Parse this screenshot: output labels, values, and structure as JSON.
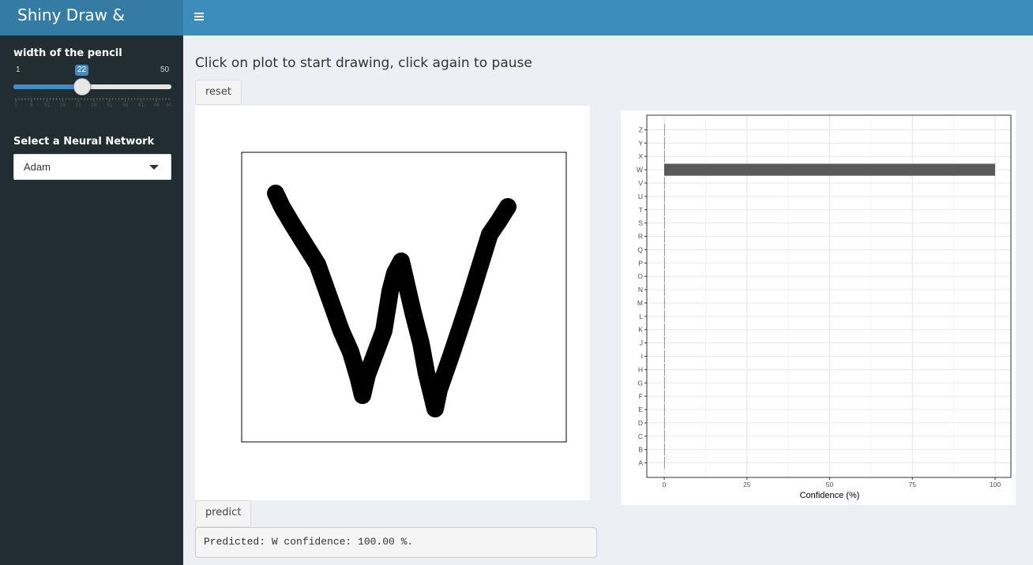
{
  "app": {
    "title": "Shiny Draw & Predict"
  },
  "header": {
    "toggle_icon": "hamburger-icon"
  },
  "sidebar": {
    "slider": {
      "label": "width of the pencil",
      "min": "1",
      "max": "50",
      "value": "22",
      "tick_labels": [
        "1",
        "6",
        "11",
        "16",
        "21",
        "26",
        "31",
        "36",
        "41",
        "46",
        "50"
      ]
    },
    "select": {
      "label": "Select a Neural Network",
      "value": "Adam"
    }
  },
  "main": {
    "instructions": "Click on plot to start drawing, click again to pause",
    "reset_label": "reset",
    "predict_label": "predict",
    "prediction_text": "Predicted: W confidence: 100.00 %."
  },
  "chart_data": {
    "type": "bar",
    "orientation": "horizontal",
    "categories": [
      "A",
      "B",
      "C",
      "D",
      "E",
      "F",
      "G",
      "H",
      "I",
      "J",
      "K",
      "L",
      "M",
      "N",
      "O",
      "P",
      "Q",
      "R",
      "S",
      "T",
      "U",
      "V",
      "W",
      "X",
      "Y",
      "Z"
    ],
    "values": [
      0,
      0,
      0,
      0,
      0,
      0,
      0,
      0,
      0,
      0,
      0,
      0,
      0,
      0,
      0,
      0,
      0,
      0,
      0,
      0,
      0,
      0,
      100,
      0,
      0,
      0
    ],
    "xlabel": "Confidence (%)",
    "ylabel": "",
    "xlim": [
      0,
      100
    ],
    "xticks": [
      0,
      25,
      50,
      75,
      100
    ],
    "grid": true,
    "bar_color": "#595959"
  },
  "colors": {
    "header": "#3c8dbc",
    "logo_bg": "#357ca5",
    "sidebar": "#222d32",
    "accent": "#428bca"
  }
}
